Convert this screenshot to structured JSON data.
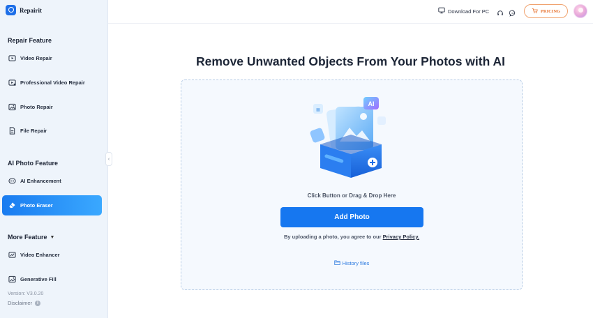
{
  "app": {
    "name": "Repairit"
  },
  "sidebar": {
    "sections": [
      {
        "title": "Repair Feature"
      },
      {
        "title": "AI Photo Feature"
      },
      {
        "title": "More Feature"
      }
    ],
    "items": [
      {
        "label": "Video Repair",
        "icon": "video-play-icon"
      },
      {
        "label": "Professional Video Repair",
        "icon": "video-pro-icon"
      },
      {
        "label": "Photo Repair",
        "icon": "photo-icon"
      },
      {
        "label": "File Repair",
        "icon": "file-icon"
      },
      {
        "label": "AI Enhancement",
        "icon": "enhance-icon"
      },
      {
        "label": "Photo Eraser",
        "icon": "eraser-icon",
        "active": true
      },
      {
        "label": "Video Enhancer",
        "icon": "video-enhancer-icon"
      },
      {
        "label": "Generative Fill",
        "icon": "generative-fill-icon"
      }
    ],
    "version": "Version: V3.0.20",
    "disclaimer": "Disclaimer",
    "collapse_glyph": "‹"
  },
  "topbar": {
    "download_label": "Download For PC",
    "pricing_label": "PRICING"
  },
  "main": {
    "headline": "Remove Unwanted Objects From Your Photos with AI",
    "drop_hint": "Click Button or Drag & Drop Here",
    "add_photo_label": "Add Photo",
    "agree_prefix": "By uploading a photo, you agree to our ",
    "policy_link": "Privacy Policy.",
    "history_label": "History files",
    "illustration_badge": "AI"
  },
  "colors": {
    "accent": "#1677f0",
    "sidebar_bg": "#eef4fb",
    "pricing": "#e6722f"
  }
}
